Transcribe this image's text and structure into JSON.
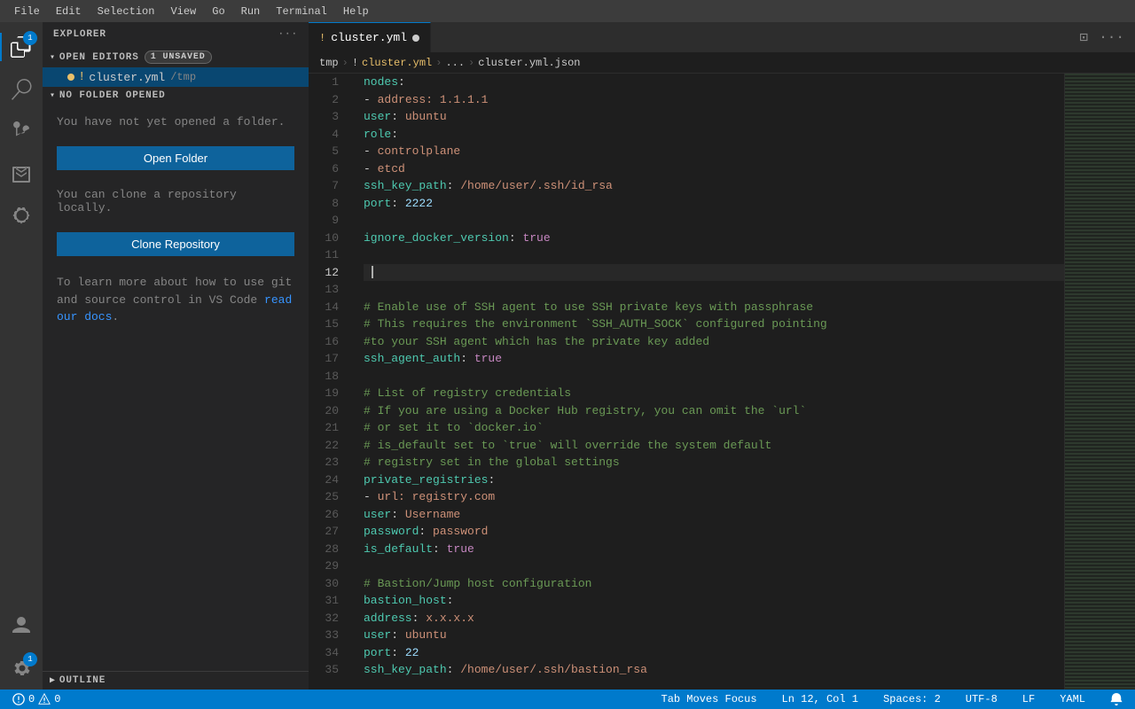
{
  "menu": {
    "items": [
      "File",
      "Edit",
      "Selection",
      "View",
      "Go",
      "Run",
      "Terminal",
      "Help"
    ]
  },
  "activity_bar": {
    "icons": [
      {
        "name": "explorer-icon",
        "symbol": "⎘",
        "active": true,
        "badge": "1"
      },
      {
        "name": "search-icon",
        "symbol": "🔍",
        "active": false
      },
      {
        "name": "source-control-icon",
        "symbol": "⎇",
        "active": false
      },
      {
        "name": "run-icon",
        "symbol": "▷",
        "active": false
      },
      {
        "name": "extensions-icon",
        "symbol": "⧉",
        "active": false
      }
    ],
    "bottom_icons": [
      {
        "name": "account-icon",
        "symbol": "👤"
      },
      {
        "name": "settings-icon",
        "symbol": "⚙",
        "badge": "1"
      }
    ]
  },
  "sidebar": {
    "title": "EXPLORER",
    "open_editors": {
      "label": "OPEN EDITORS",
      "badge": "1 UNSAVED",
      "files": [
        {
          "dot": true,
          "icon": "!",
          "name": "cluster.yml",
          "path": "/tmp"
        }
      ]
    },
    "no_folder": {
      "label": "NO FOLDER OPENED",
      "message": "You have not yet opened a folder.",
      "open_btn": "Open Folder",
      "clone_message": "You can clone a repository locally.",
      "clone_btn": "Clone Repository",
      "git_text": "To learn more about how to use git and source control in VS Code ",
      "git_link": "read our docs",
      "git_end": "."
    },
    "outline": {
      "label": "OUTLINE"
    }
  },
  "editor": {
    "tab": {
      "icon": "!",
      "filename": "cluster.yml",
      "modified": true
    },
    "breadcrumb": {
      "parts": [
        "tmp",
        "!",
        "cluster.yml",
        "...",
        "cluster.yml.json"
      ]
    },
    "lines": [
      {
        "num": 1,
        "text": "nodes:"
      },
      {
        "num": 2,
        "text": "  - address: 1.1.1.1"
      },
      {
        "num": 3,
        "text": "    user: ubuntu"
      },
      {
        "num": 4,
        "text": "    role:"
      },
      {
        "num": 5,
        "text": "      - controlplane"
      },
      {
        "num": 6,
        "text": "      - etcd"
      },
      {
        "num": 7,
        "text": "    ssh_key_path: /home/user/.ssh/id_rsa"
      },
      {
        "num": 8,
        "text": "    port: 2222"
      },
      {
        "num": 9,
        "text": ""
      },
      {
        "num": 10,
        "text": "ignore_docker_version: true"
      },
      {
        "num": 11,
        "text": ""
      },
      {
        "num": 12,
        "text": ""
      },
      {
        "num": 13,
        "text": ""
      },
      {
        "num": 14,
        "text": "# Enable use of SSH agent to use SSH private keys with passphrase"
      },
      {
        "num": 15,
        "text": "# This requires the environment `SSH_AUTH_SOCK` configured pointing"
      },
      {
        "num": 16,
        "text": "#to your SSH agent which has the private key added"
      },
      {
        "num": 17,
        "text": "ssh_agent_auth: true"
      },
      {
        "num": 18,
        "text": ""
      },
      {
        "num": 19,
        "text": "# List of registry credentials"
      },
      {
        "num": 20,
        "text": "# If you are using a Docker Hub registry, you can omit the `url`"
      },
      {
        "num": 21,
        "text": "# or set it to `docker.io`"
      },
      {
        "num": 22,
        "text": "# is_default set to `true` will override the system default"
      },
      {
        "num": 23,
        "text": "# registry set in the global settings"
      },
      {
        "num": 24,
        "text": "private_registries:"
      },
      {
        "num": 25,
        "text": "      - url: registry.com"
      },
      {
        "num": 26,
        "text": "        user: Username"
      },
      {
        "num": 27,
        "text": "        password: password"
      },
      {
        "num": 28,
        "text": "        is_default: true"
      },
      {
        "num": 29,
        "text": ""
      },
      {
        "num": 30,
        "text": "# Bastion/Jump host configuration"
      },
      {
        "num": 31,
        "text": "bastion_host:"
      },
      {
        "num": 32,
        "text": "  address: x.x.x.x"
      },
      {
        "num": 33,
        "text": "  user: ubuntu"
      },
      {
        "num": 34,
        "text": "  port: 22"
      },
      {
        "num": 35,
        "text": "  ssh_key_path: /home/user/.ssh/bastion_rsa"
      }
    ]
  },
  "status_bar": {
    "errors": "0",
    "warnings": "0",
    "tab_moves_focus": "Tab Moves Focus",
    "position": "Ln 12, Col 1",
    "spaces": "Spaces: 2",
    "encoding": "UTF-8",
    "line_ending": "LF",
    "language": "YAML",
    "notifications": "🔔"
  }
}
